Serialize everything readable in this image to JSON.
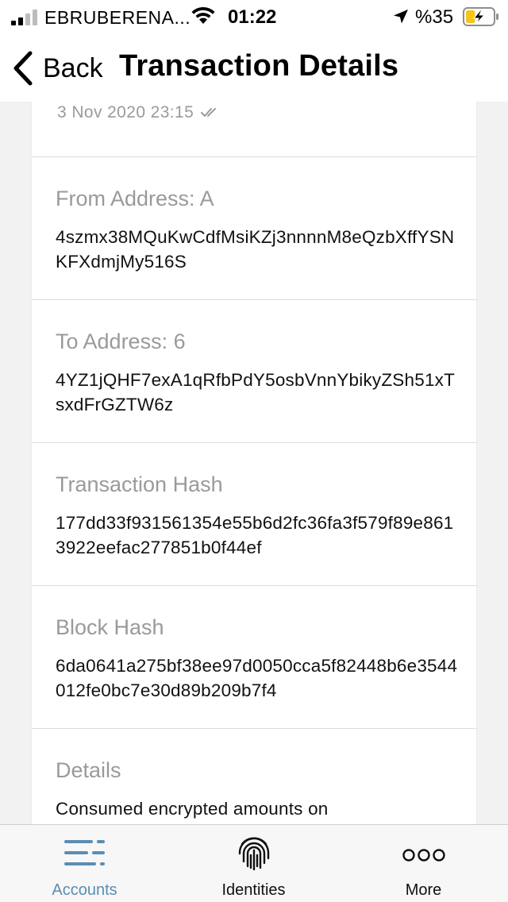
{
  "status_bar": {
    "carrier": "EBRUBERENA...",
    "time": "01:22",
    "battery_percent": "%35",
    "battery_level": 0.35,
    "charging": true
  },
  "nav": {
    "back_label": "Back",
    "title": "Transaction Details"
  },
  "transaction": {
    "date": "3 Nov 2020 23:15",
    "sections": [
      {
        "label": "From Address: A",
        "value": "4szmx38MQuKwCdfMsiKZj3nnnnM8eQzbXffYSNKFXdmjMy516S"
      },
      {
        "label": "To Address: 6",
        "value": "4YZ1jQHF7exA1qRfbPdY5osbVnnYbikyZSh51xTsxdFrGZTW6z"
      },
      {
        "label": "Transaction Hash",
        "value": "177dd33f931561354e55b6d2fc36fa3f579f89e8613922eefac277851b0f44ef"
      },
      {
        "label": "Block Hash",
        "value": "6da0641a275bf38ee97d0050cca5f82448b6e3544012fe0bc7e30d89b209b7f4"
      },
      {
        "label": "Details",
        "value": "Consumed encrypted amounts on"
      }
    ]
  },
  "tab_bar": {
    "tabs": [
      {
        "label": "Accounts",
        "icon": "accounts-list-icon",
        "active": true
      },
      {
        "label": "Identities",
        "icon": "fingerprint-icon",
        "active": false
      },
      {
        "label": "More",
        "icon": "more-dots-icon",
        "active": false
      }
    ]
  },
  "colors": {
    "accent": "#5b8db3",
    "secondary_text": "#9a9a9a",
    "battery_charge": "#f5c518"
  }
}
